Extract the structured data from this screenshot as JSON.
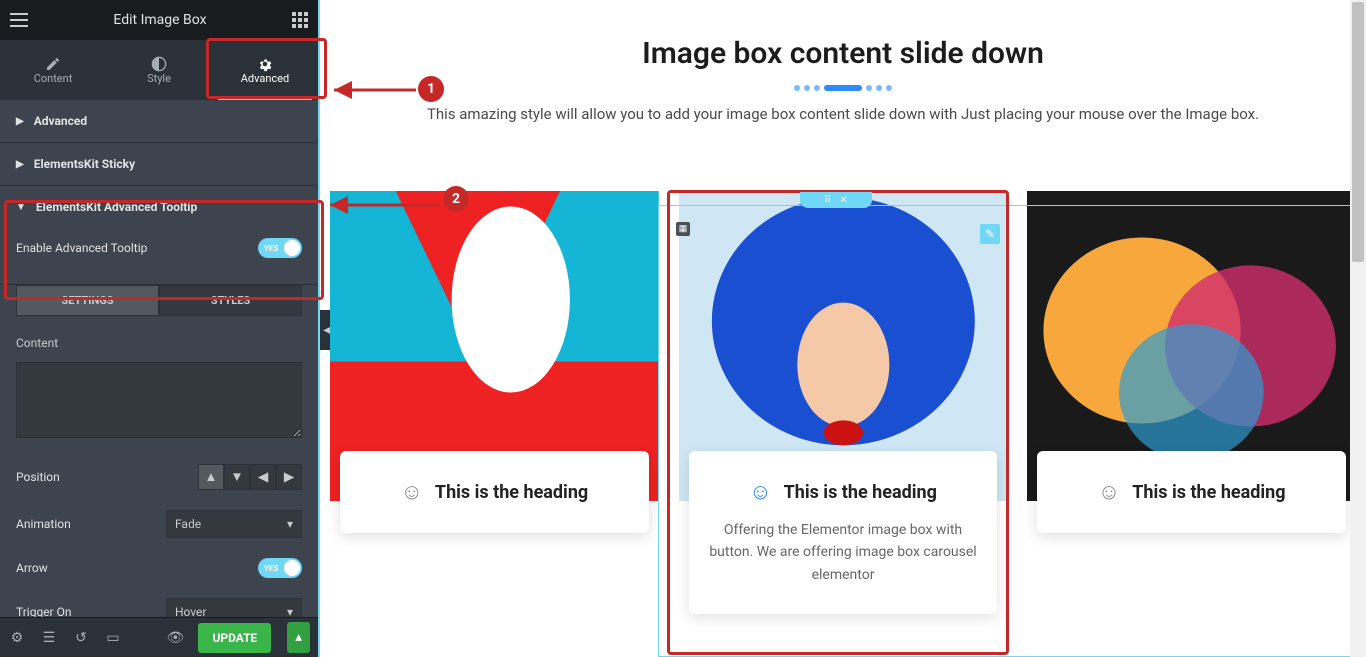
{
  "top_title": "Edit Image Box",
  "tabs": {
    "content": "Content",
    "style": "Style",
    "advanced": "Advanced"
  },
  "accordions": {
    "advanced": "Advanced",
    "sticky": "ElementsKit Sticky",
    "tooltip": "ElementsKit Advanced Tooltip"
  },
  "tooltip": {
    "enable_label": "Enable Advanced Tooltip",
    "toggle_text": "YES"
  },
  "subtabs": {
    "settings": "SETTINGS",
    "styles": "STYLES"
  },
  "fields": {
    "content": "Content",
    "position": "Position",
    "animation": "Animation",
    "animation_value": "Fade",
    "arrow": "Arrow",
    "arrow_toggle": "YES",
    "trigger": "Trigger On",
    "trigger_value": "Hover"
  },
  "update": "UPDATE",
  "preview": {
    "heading": "Image box content slide down",
    "subtitle": "This amazing style will allow you to add your image box content slide down with Just placing your mouse over the Image box.",
    "card_heading": "This is the heading",
    "card_text": "Offering the Elementor image box with button. We are offering image box carousel elementor"
  },
  "annotations": {
    "num1": "1",
    "num2": "2"
  }
}
